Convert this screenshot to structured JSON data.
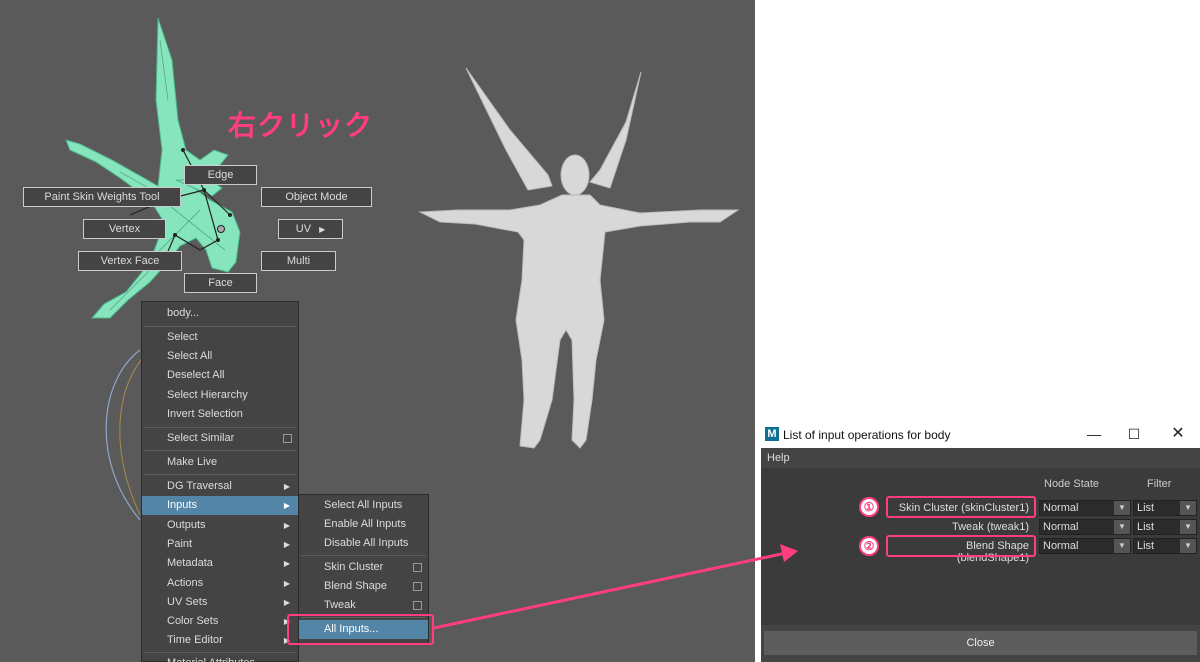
{
  "callout": "右クリック",
  "marking_menu": {
    "edge": "Edge",
    "paint_skin_weights": "Paint Skin Weights Tool",
    "object_mode": "Object Mode",
    "vertex": "Vertex",
    "uv": "UV",
    "vertex_face": "Vertex Face",
    "multi": "Multi",
    "face": "Face"
  },
  "context_menu": {
    "items": [
      {
        "label": "body..."
      },
      {
        "label": "Select"
      },
      {
        "label": "Select All"
      },
      {
        "label": "Deselect All"
      },
      {
        "label": "Select Hierarchy"
      },
      {
        "label": "Invert Selection"
      },
      {
        "label": "Select Similar"
      },
      {
        "label": "Make Live"
      },
      {
        "label": "DG Traversal"
      },
      {
        "label": "Inputs"
      },
      {
        "label": "Outputs"
      },
      {
        "label": "Paint"
      },
      {
        "label": "Metadata"
      },
      {
        "label": "Actions"
      },
      {
        "label": "UV Sets"
      },
      {
        "label": "Color Sets"
      },
      {
        "label": "Time Editor"
      },
      {
        "label": "Material Attributes..."
      }
    ],
    "highlighted": "Inputs"
  },
  "inputs_submenu": {
    "items": [
      {
        "label": "Select All Inputs"
      },
      {
        "label": "Enable All Inputs"
      },
      {
        "label": "Disable All Inputs"
      },
      {
        "label": "Skin Cluster"
      },
      {
        "label": "Blend Shape"
      },
      {
        "label": "Tweak"
      },
      {
        "label": "All Inputs..."
      }
    ],
    "highlighted": "All Inputs..."
  },
  "dialog": {
    "icon_letter": "M",
    "title": "List of input operations for body",
    "menu_help": "Help",
    "col_node_state": "Node State",
    "col_filter": "Filter",
    "rows": [
      {
        "marker": "①",
        "label": "Skin Cluster (skinCluster1)",
        "state": "Normal",
        "filter": "List"
      },
      {
        "marker": "",
        "label": "Tweak (tweak1)",
        "state": "Normal",
        "filter": "List"
      },
      {
        "marker": "②",
        "label": "Blend Shape (blendShape1)",
        "state": "Normal",
        "filter": "List"
      }
    ],
    "close_label": "Close"
  },
  "colors": {
    "accent_pink": "#ff3d7f",
    "highlight_blue": "#5285a6",
    "viewport_bg": "#5a5a5a",
    "mesh_green": "#7ee0b4"
  },
  "icons": [
    "submenu-arrow-icon",
    "checkbox-icon",
    "dropdown-arrow-icon",
    "minimize-icon",
    "maximize-icon",
    "close-window-icon",
    "maya-logo-icon"
  ]
}
